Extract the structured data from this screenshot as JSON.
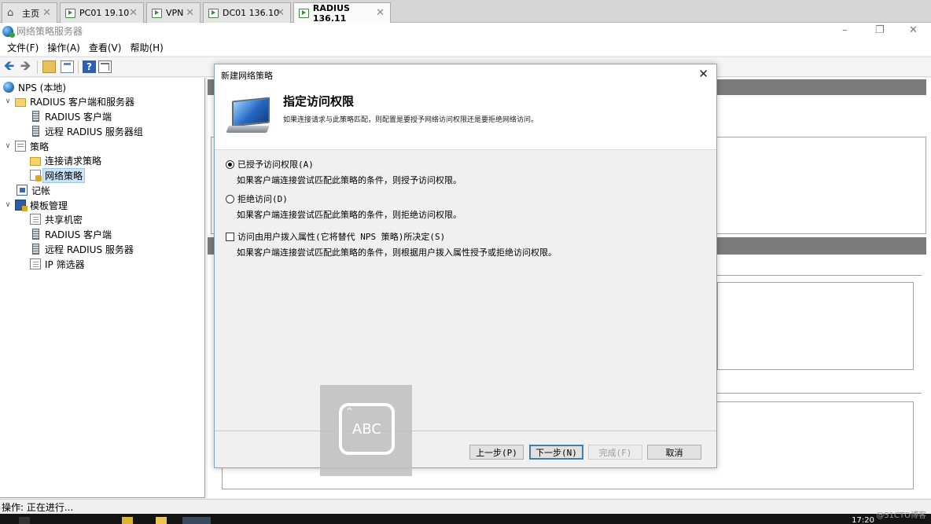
{
  "vm_tabs": [
    {
      "label": "主页",
      "icon": "home-icon"
    },
    {
      "label": "PC01  19.10",
      "icon": "vm-icon"
    },
    {
      "label": "VPN",
      "icon": "vm-icon"
    },
    {
      "label": "DC01  136.10",
      "icon": "vm-icon"
    },
    {
      "label": "RADIUS  136.11",
      "icon": "vm-icon",
      "active": true
    }
  ],
  "window": {
    "title": "网络策略服务器",
    "minimize": "–",
    "restore": "❐",
    "close": "✕"
  },
  "menu": [
    "文件(F)",
    "操作(A)",
    "查看(V)",
    "帮助(H)"
  ],
  "toolbar": {
    "back": "🡸",
    "forward": "🡺",
    "help": "?"
  },
  "tree": [
    {
      "label": "NPS (本地)",
      "icon": "globe-icon",
      "expand": ""
    },
    {
      "label": "RADIUS 客户端和服务器",
      "icon": "folder-icon",
      "expand": "v"
    },
    {
      "label": "RADIUS 客户端",
      "icon": "server-icon",
      "expand": ""
    },
    {
      "label": "远程 RADIUS 服务器组",
      "icon": "server-icon",
      "expand": ""
    },
    {
      "label": "策略",
      "icon": "policy-icon",
      "expand": "v"
    },
    {
      "label": "连接请求策略",
      "icon": "folder-icon",
      "expand": ""
    },
    {
      "label": "网络策略",
      "icon": "network-policy-icon",
      "expand": "",
      "selected": true
    },
    {
      "label": "记帐",
      "icon": "accounting-icon",
      "expand": ""
    },
    {
      "label": "模板管理",
      "icon": "template-icon",
      "expand": "v"
    },
    {
      "label": "共享机密",
      "icon": "document-icon",
      "expand": ""
    },
    {
      "label": "RADIUS 客户端",
      "icon": "server-icon",
      "expand": ""
    },
    {
      "label": "远程 RADIUS 服务器",
      "icon": "server-icon",
      "expand": ""
    },
    {
      "label": "IP 筛选器",
      "icon": "document-icon",
      "expand": ""
    }
  ],
  "status": "操作:  正在进行...",
  "taskbar": {
    "clock": "17:20"
  },
  "watermark": "@51CTO博客",
  "dialog": {
    "title": "新建网络策略",
    "close": "✕",
    "heading": "指定访问权限",
    "description": "如果连接请求与此策略匹配，则配置是要授予网络访问权限还是要拒绝网络访问。",
    "options": [
      {
        "type": "radio",
        "checked": true,
        "label": "已授予访问权限(A)",
        "desc": "如果客户端连接尝试匹配此策略的条件，则授予访问权限。"
      },
      {
        "type": "radio",
        "checked": false,
        "label": "拒绝访问(D)",
        "desc": "如果客户端连接尝试匹配此策略的条件，则拒绝访问权限。"
      },
      {
        "type": "checkbox",
        "checked": false,
        "label": "访问由用户拨入属性(它将替代 NPS 策略)所决定(S)",
        "desc": "如果客户端连接尝试匹配此策略的条件，则根据用户拨入属性授予或拒绝访问权限。"
      }
    ],
    "buttons": {
      "prev": "上一步(P)",
      "next": "下一步(N)",
      "finish": "完成(F)",
      "cancel": "取消"
    }
  },
  "ime": {
    "label": "ABC",
    "caret": "^"
  }
}
